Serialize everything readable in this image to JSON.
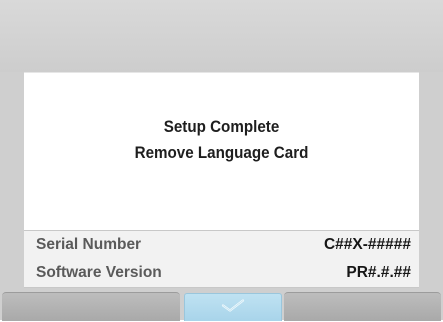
{
  "dialog": {
    "line1": "Setup Complete",
    "line2": "Remove Language Card"
  },
  "info": {
    "serial_label": "Serial Number",
    "serial_value": "C##X-#####",
    "software_label": "Software Version",
    "software_value": "PR#.#.##"
  },
  "buttons": {
    "left": "",
    "confirm_icon": "checkmark-icon",
    "right": ""
  },
  "colors": {
    "background": "#cfcfcf",
    "confirm_button": "#b6dcee"
  }
}
